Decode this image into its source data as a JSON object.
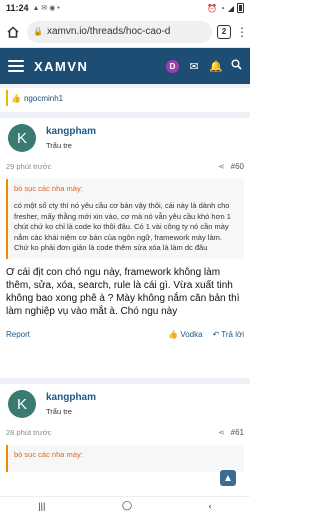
{
  "status": {
    "time": "11:24",
    "left_icons": "▲ ✉ ◉ •"
  },
  "browser": {
    "url": "xamvn.io/threads/hoc-cao-d",
    "tab_count": "2"
  },
  "site": {
    "logo": "XAMVN",
    "avatar_letter": "D"
  },
  "reactions": {
    "user": "ngocminh1"
  },
  "posts": [
    {
      "avatar_letter": "K",
      "username": "kangpham",
      "user_title": "Trẩu tre",
      "time": "29 phút trước",
      "number": "#60",
      "quote_author": "bò sục các nha mày:",
      "quote_text": "có một số cty thì nó yêu cầu cơ bản vậy thôi, cái này là dành cho fresher, mấy thằng mới xin vào, cơ mà nó vẫn yêu cầu khó hơn 1 chút chứ ko chỉ là code ko thôi đâu. Có 1 vài công ty nó cần mày nắm các khái niệm cơ bản của ngôn ngữ, framework mày làm. Chứ ko phải đơn giản là code thêm sửa xóa là làm dc đâu",
      "body": "Ơ cái địt con chó ngu này, framework không làm thêm, sửa, xóa, search, rule là cái gì. Vừa xuất tinh không bao xong phê à ? Mày không nắm căn bản thì làm nghiệp vụ vào mắt à. Chó ngu này",
      "report": "Report",
      "reaction": "Vodka",
      "reply": "Trả lời"
    },
    {
      "avatar_letter": "K",
      "username": "kangpham",
      "user_title": "Trẩu tre",
      "time": "28 phút trước",
      "number": "#61",
      "quote_author": "bò sục các nha mày:"
    }
  ]
}
